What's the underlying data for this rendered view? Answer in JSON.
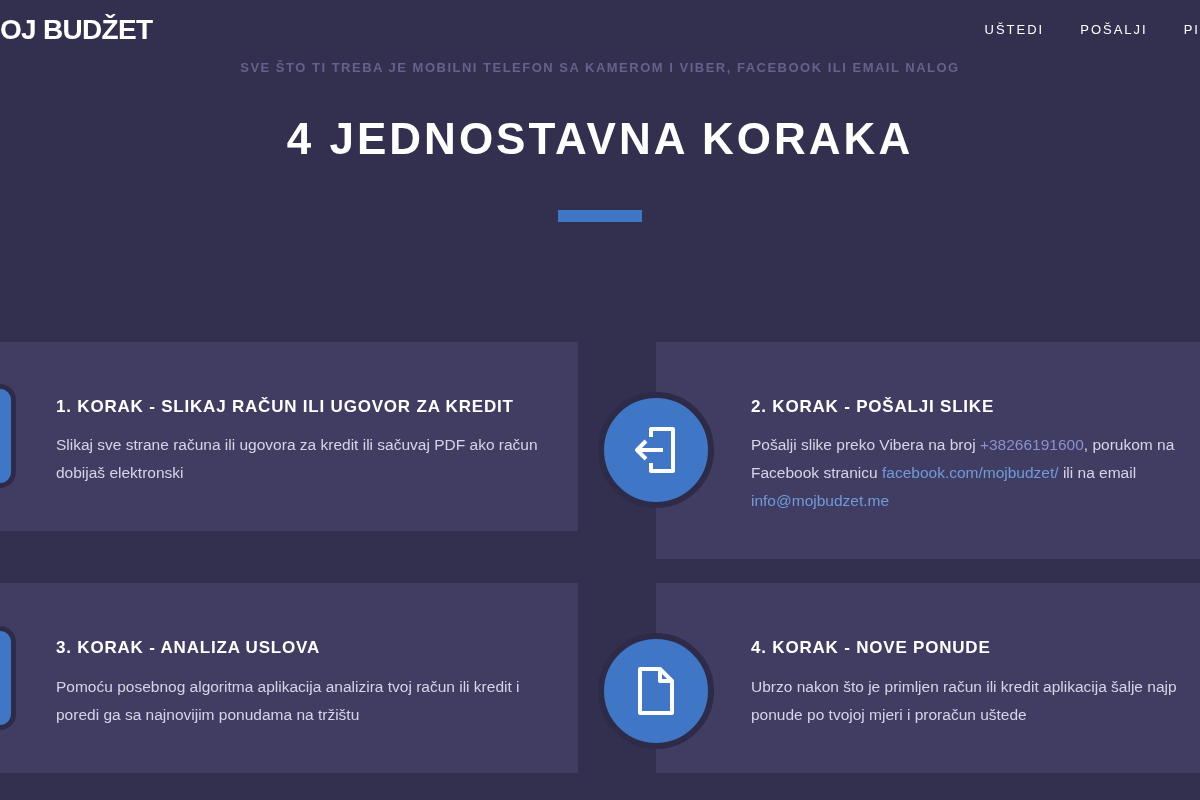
{
  "header": {
    "logo": "OJ BUDŽET",
    "nav": [
      {
        "label": "UŠTEDI"
      },
      {
        "label": "POŠALJI"
      },
      {
        "label": "PI"
      }
    ]
  },
  "subtitle": "SVE ŠTO TI TREBA JE MOBILNI TELEFON SA KAMEROM I VIBER, FACEBOOK ILI EMAIL NALOG",
  "heading": "4 JEDNOSTAVNA KORAKA",
  "steps": [
    {
      "kind": "partial",
      "title": "1. KORAK - SLIKAJ RAČUN ILI UGOVOR ZA KREDIT",
      "description": [
        {
          "kind": "text",
          "text": "Slikaj sve strane računa ili ugovora za kredit ili sačuvaj PDF ako račun dobijaš elektronski"
        }
      ]
    },
    {
      "kind": "send",
      "title": "2. KORAK - POŠALJI SLIKE",
      "description": [
        {
          "kind": "text",
          "text": "Pošalji slike preko Vibera na broj "
        },
        {
          "kind": "phone",
          "text": "+38266191600"
        },
        {
          "kind": "text",
          "text": ", porukom na Facebook stranicu "
        },
        {
          "kind": "link",
          "text": "facebook.com/mojbudzet/"
        },
        {
          "kind": "text",
          "text": " ili na email "
        },
        {
          "kind": "link",
          "text": "info@mojbudzet.me"
        }
      ]
    },
    {
      "kind": "partial",
      "title": "3. KORAK - ANALIZA USLOVA",
      "description": [
        {
          "kind": "text",
          "text": "Pomoću posebnog algoritma aplikacija analizira tvoj račun ili kredit i poredi ga sa najnovijim ponudama na tržištu"
        }
      ]
    },
    {
      "kind": "document",
      "title": "4. KORAK - NOVE PONUDE",
      "description": [
        {
          "kind": "text",
          "text": "Ubrzo nakon što je primljen račun ili kredit aplikacija šalje najp ponude po tvojoj mjeri i proračun uštede"
        }
      ]
    }
  ]
}
